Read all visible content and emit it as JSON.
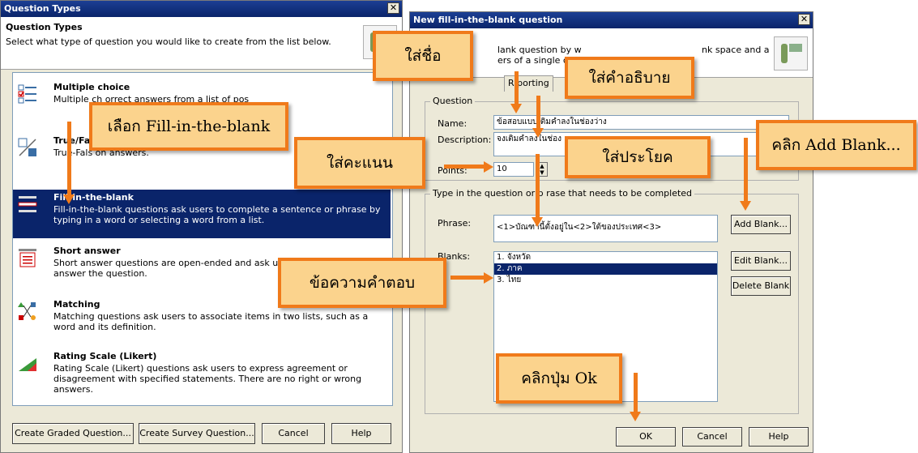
{
  "left_window": {
    "title": "Question Types",
    "heading": "Question Types",
    "subheading": "Select what type of question you would like to create from the list below.",
    "items": [
      {
        "title": "Multiple choice",
        "desc": "Multiple ch                    orrect answers from a list of pos"
      },
      {
        "title": "True/Fal",
        "desc": "True-Fals                                          on answers."
      },
      {
        "title": "Fill-in-the-blank",
        "desc": "Fill-in-the-blank questions ask users to complete a sentence or phrase by typing in a word or selecting a word from a list."
      },
      {
        "title": "Short answer",
        "desc": "Short answer questions are open-ended and ask users to phrase to answer the question."
      },
      {
        "title": "Matching",
        "desc": "Matching questions ask users to associate items in two lists, such as a word and its definition."
      },
      {
        "title": "Rating Scale (Likert)",
        "desc": "Rating Scale (Likert) questions ask users to express agreement or disagreement with specified statements. There are no right or wrong answers."
      }
    ],
    "buttons": {
      "graded": "Create Graded Question...",
      "survey": "Create Survey Question...",
      "cancel": "Cancel",
      "help": "Help"
    }
  },
  "right_window": {
    "title": "New fill-in-the-blank question",
    "header_text1": "lank question by w",
    "header_text2": "ers of a single cor",
    "header_text3": "nk space and a",
    "tabs": [
      "R porting"
    ],
    "question_group": "Question",
    "name_label": "Name:",
    "name_value": "ข้อสอบแบบเติมคำลงในช่องว่าง",
    "description_label": "Description:",
    "description_value": "จงเติมคำลงในช่อง",
    "points_label": "Points:",
    "points_value": "10",
    "phrase_group": "Type in the question or p  rase that needs to be completed",
    "phrase_label": "Phrase:",
    "phrase_value": "<1>บัณฑานี้ตั้งอยู่ใน<2>ใต้ของประเทศ<3>",
    "blanks_label": "Blanks:",
    "blanks": [
      "1.   จังหวัด",
      "2.   ภาค",
      "3.   ไทย"
    ],
    "buttons": {
      "add_blank": "Add Blank...",
      "edit_blank": "Edit Blank...",
      "delete_blank": "Delete Blank",
      "ok": "OK",
      "cancel": "Cancel",
      "help": "Help"
    }
  },
  "callouts": {
    "name": "ใส่ชื่อ",
    "description": "ใส่คำอธิบาย",
    "choose": "เลือก Fill-in-the-blank",
    "points": "ใส่คะแนน",
    "sentence": "ใส่ประโยค",
    "add_blank": "คลิก Add Blank...",
    "answer": "ข้อความคำตอบ",
    "ok": "คลิกปุ่ม Ok"
  }
}
